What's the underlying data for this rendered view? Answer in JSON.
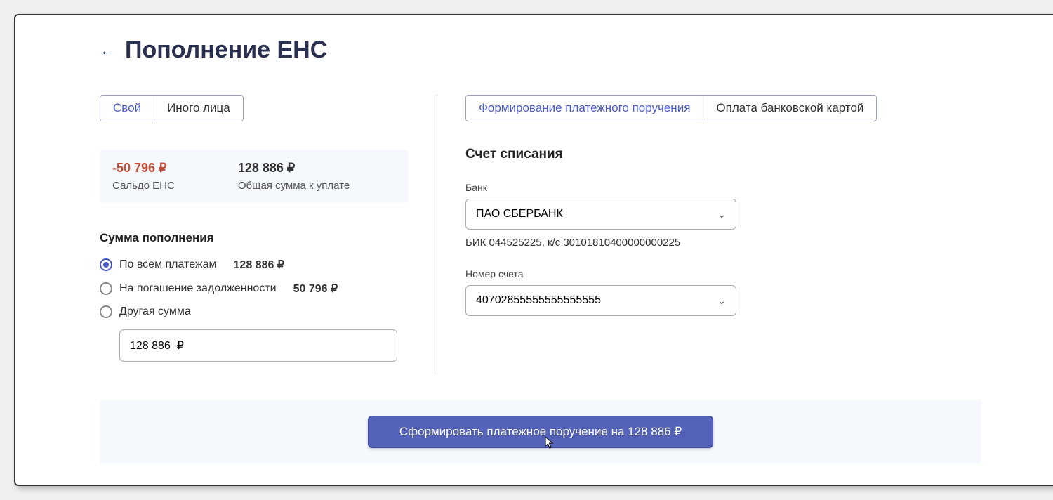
{
  "header": {
    "title": "Пополнение ЕНС"
  },
  "leftPanel": {
    "tabs": [
      "Свой",
      "Иного лица"
    ],
    "info": {
      "balance_value": "-50 796 ₽",
      "balance_label": "Сальдо ЕНС",
      "total_value": "128 886 ₽",
      "total_label": "Общая сумма к уплате"
    },
    "amountSection": {
      "heading": "Сумма пополнения",
      "options": [
        {
          "label": "По всем платежам",
          "amount": "128 886 ₽"
        },
        {
          "label": "На погашение задолженности",
          "amount": "50 796 ₽"
        },
        {
          "label": "Другая сумма",
          "amount": ""
        }
      ],
      "input_value": "128 886  ₽"
    }
  },
  "rightPanel": {
    "tabs": [
      "Формирование платежного поручения",
      "Оплата банковской картой"
    ],
    "section_title": "Счет списания",
    "bank": {
      "label": "Банк",
      "value": "ПАО СБЕРБАНК",
      "detail": "БИК 044525225, к/с 30101810400000000225"
    },
    "account": {
      "label": "Номер счета",
      "value": "40702855555555555555"
    }
  },
  "footer": {
    "button": "Сформировать платежное поручение на 128 886 ₽"
  }
}
